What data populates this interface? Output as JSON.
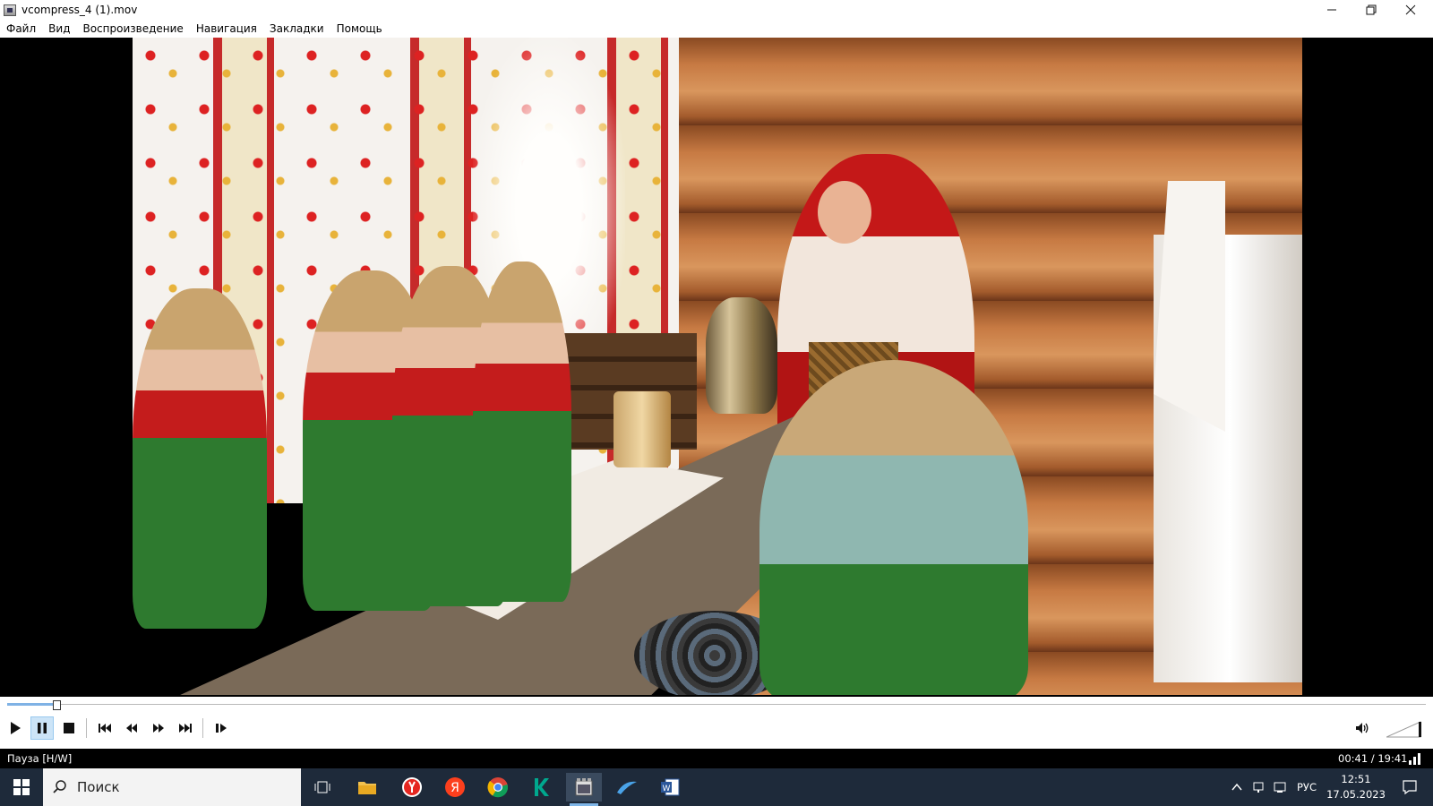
{
  "window": {
    "title": "vcompress_4 (1).mov",
    "minimize_icon": "minimize-icon",
    "maximize_icon": "restore-icon",
    "close_icon": "close-icon"
  },
  "menu": {
    "items": [
      "Файл",
      "Вид",
      "Воспроизведение",
      "Навигация",
      "Закладки",
      "Помощь"
    ]
  },
  "player": {
    "progress": 0.035,
    "buttons": [
      "play-icon",
      "pause-icon",
      "stop-icon",
      "skip-previous-icon",
      "rewind-icon",
      "fast-forward-icon",
      "skip-next-icon",
      "frame-step-icon"
    ],
    "pause_active": true,
    "volume_icon": "speaker-icon"
  },
  "status": {
    "state": "Пауза [H/W]",
    "time": "00:41 / 19:41"
  },
  "taskbar": {
    "search_placeholder": "Поиск",
    "language": "РУС",
    "clock_time": "12:51",
    "clock_date": "17.05.2023"
  },
  "colors": {
    "accent": "#7fb2e5",
    "taskbar_bg": "#1e2a3a"
  }
}
